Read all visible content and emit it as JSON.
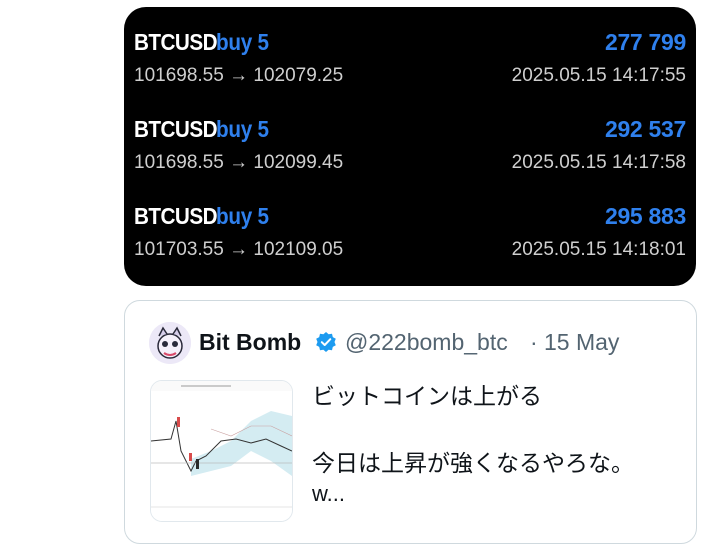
{
  "trades": [
    {
      "symbol": "BTCUSD",
      "action": "buy 5",
      "amount": "277 799",
      "prices": "101698.55 → 102079.25",
      "time": "2025.05.15 14:17:55"
    },
    {
      "symbol": "BTCUSD",
      "action": "buy 5",
      "amount": "292 537",
      "prices": "101698.55 → 102099.45",
      "time": "2025.05.15 14:17:58"
    },
    {
      "symbol": "BTCUSD",
      "action": "buy 5",
      "amount": "295 883",
      "prices": "101703.55 → 102109.05",
      "time": "2025.05.15 14:18:01"
    }
  ],
  "quote": {
    "author": "Bit Bomb",
    "handle": "@222bomb_btc",
    "separator": "·",
    "date": "15 May",
    "text_line1": "ビットコインは上がる",
    "text_line2": "今日は上昇が強くなるやろな。",
    "text_line3": "w..."
  },
  "colors": {
    "accent": "#2f80ed",
    "verified": "#1d9bf0",
    "card_bg": "#000000"
  },
  "icons": {
    "verified": "verified-badge-icon",
    "avatar": "avatar-icon",
    "chart": "chart-thumbnail"
  }
}
